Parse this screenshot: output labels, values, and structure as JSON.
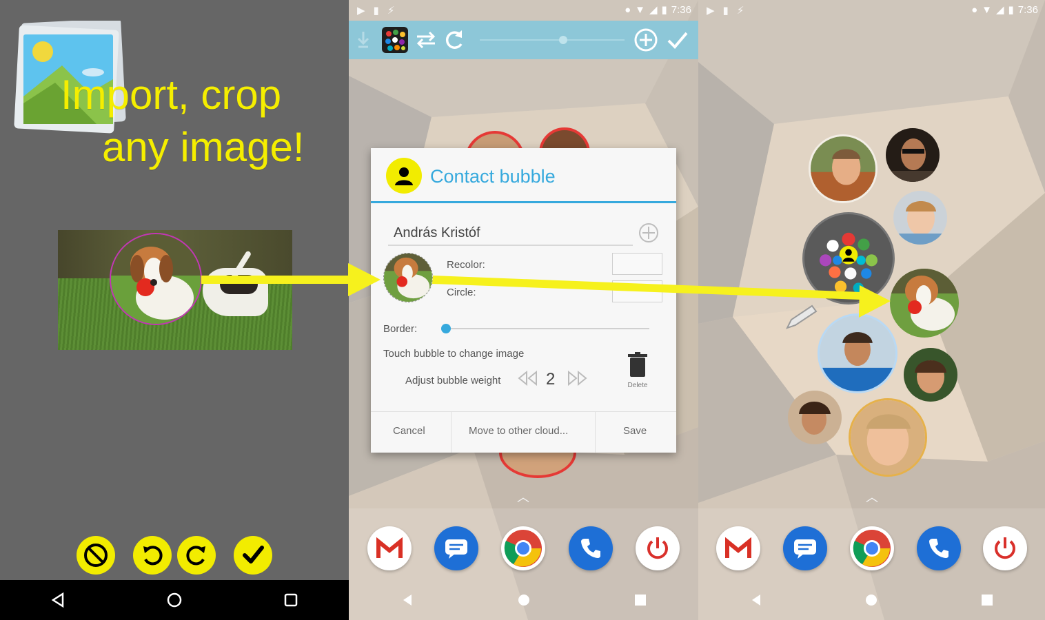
{
  "promo": {
    "line1": "Import, crop",
    "line2": "any image!"
  },
  "status": {
    "time_middle": "7:36",
    "time_right": "7:36"
  },
  "dialog": {
    "title": "Contact bubble",
    "contact_name": "András Kristóf",
    "recolor_label": "Recolor:",
    "circle_label": "Circle:",
    "border_label": "Border:",
    "touch_hint": "Touch bubble to change image",
    "weight_label": "Adjust bubble weight",
    "weight_value": "2",
    "delete_label": "Delete",
    "cancel_label": "Cancel",
    "move_label": "Move to other cloud...",
    "save_label": "Save",
    "border_slider": 0
  },
  "icons": {
    "gallery": "gallery-icon",
    "cancel": "cancel-icon",
    "rotate_left": "rotate-left-icon",
    "rotate_right": "rotate-right-icon",
    "confirm": "checkmark-icon",
    "refresh": "refresh-icon",
    "swap": "swap-icon",
    "add": "add-circle-icon",
    "delete": "trash-icon"
  },
  "colors": {
    "accent_yellow": "#f2ec00",
    "dialog_blue": "#36a9dd",
    "toolbar_blue": "#8dc7d8",
    "panel_gray": "#666666"
  }
}
